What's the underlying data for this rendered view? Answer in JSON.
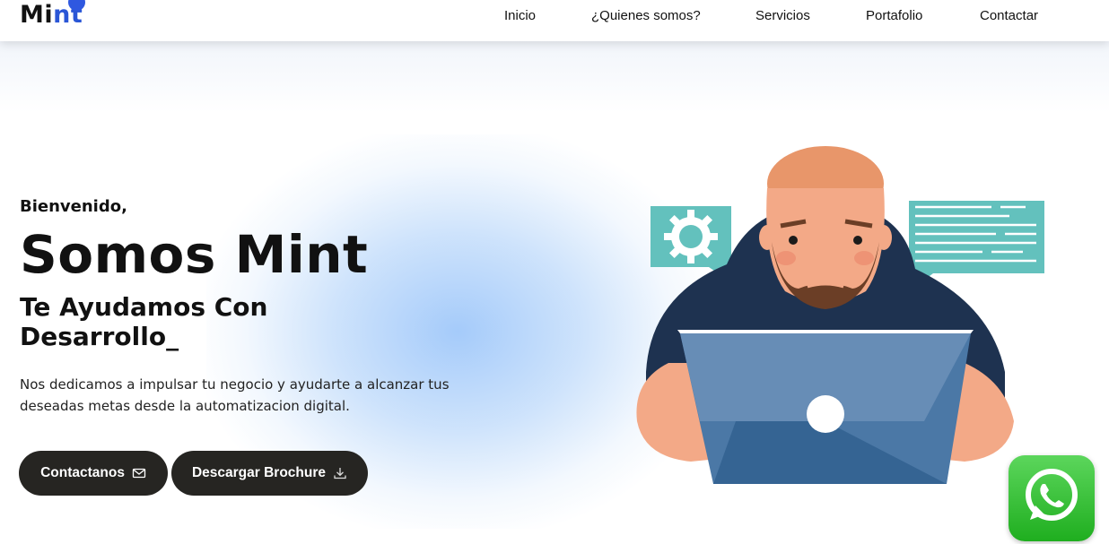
{
  "header": {
    "logo": {
      "main": "Mi",
      "accent": "nt"
    },
    "nav": [
      {
        "label": "Inicio"
      },
      {
        "label": "¿Quienes somos?"
      },
      {
        "label": "Servicios"
      },
      {
        "label": "Portafolio"
      },
      {
        "label": "Contactar"
      }
    ]
  },
  "hero": {
    "greeting": "Bienvenido,",
    "title": "Somos Mint",
    "subtitle": "Te Ayudamos Con Desarrollo_",
    "description": "Nos dedicamos a impulsar tu negocio y ayudarte a alcanzar tus deseadas metas desde la automatizacion digital.",
    "buttons": [
      {
        "label": "Contactanos",
        "icon": "mail-icon"
      },
      {
        "label": "Descargar Brochure",
        "icon": "download-icon"
      }
    ]
  },
  "illustration": {
    "icons": [
      "gear-icon",
      "document-lines-icon",
      "laptop-icon",
      "developer-person"
    ]
  },
  "floating": {
    "icon": "whatsapp-icon"
  },
  "colors": {
    "brand_blue": "#2f58e0",
    "button_dark": "#262522",
    "teal": "#63c1bd",
    "hoodie": "#1e3250",
    "laptop": "#3d6ea0",
    "skin": "#f3a987",
    "whatsapp_green": "#2ebd2e"
  }
}
